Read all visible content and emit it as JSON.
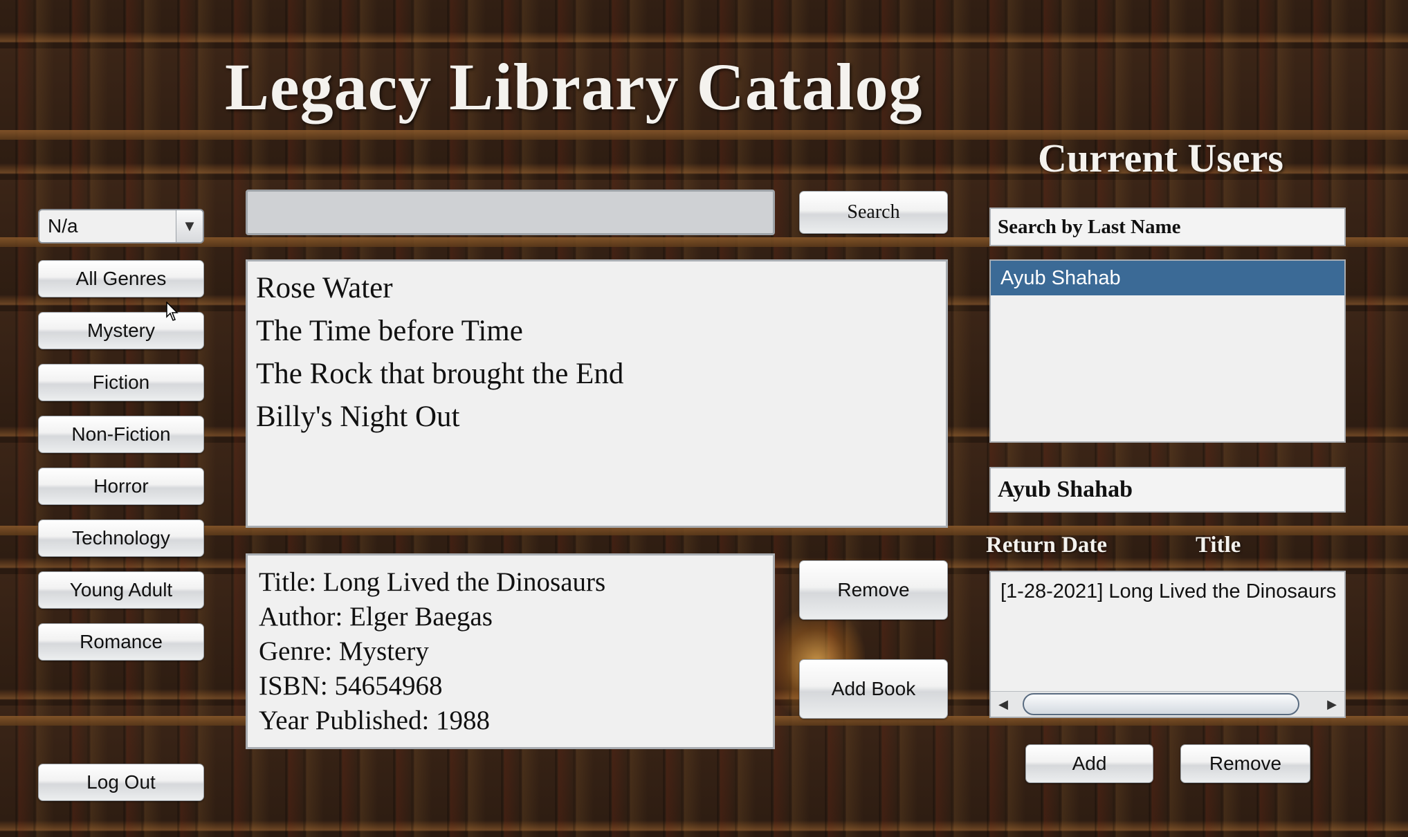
{
  "app": {
    "title": "Legacy Library Catalog"
  },
  "genre_filter": {
    "selected": "N/a",
    "buttons": [
      "All Genres",
      "Mystery",
      "Fiction",
      "Non-Fiction",
      "Horror",
      "Technology",
      "Young Adult",
      "Romance"
    ]
  },
  "logout_label": "Log Out",
  "search": {
    "value": "",
    "button_label": "Search"
  },
  "books": [
    "Rose Water",
    "The Time before Time",
    "The Rock that brought the End",
    "Billy's Night Out"
  ],
  "book_details": {
    "title": "Title: Long Lived the Dinosaurs",
    "author": "Author: Elger Baegas",
    "genre": "Genre: Mystery",
    "isbn": "ISBN: 54654968",
    "year": "Year Published: 1988"
  },
  "book_actions": {
    "remove_label": "Remove",
    "add_label": "Add Book"
  },
  "users": {
    "heading": "Current Users",
    "search_placeholder": "Search by Last Name",
    "list": [
      "Ayub Shahab"
    ],
    "selected_name": "Ayub Shahab",
    "columns": {
      "return_date": "Return Date",
      "title": "Title"
    },
    "loans": [
      "[1-28-2021]  Long Lived the Dinosaurs"
    ],
    "add_label": "Add",
    "remove_label": "Remove"
  }
}
